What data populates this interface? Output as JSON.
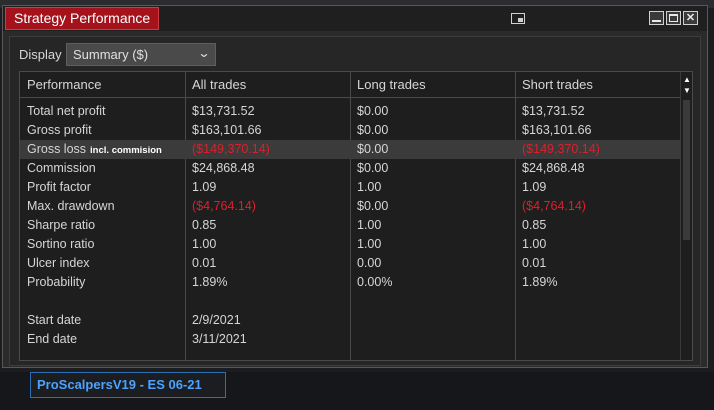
{
  "window": {
    "title": "Strategy Performance",
    "close_symbol": "✕"
  },
  "display": {
    "label": "Display",
    "selected": "Summary ($)"
  },
  "table": {
    "headers": [
      "Performance",
      "All trades",
      "Long trades",
      "Short trades"
    ],
    "rows": [
      {
        "label": "Total net profit",
        "note": "",
        "all": "$13,731.52",
        "long": "$0.00",
        "short": "$13,731.52"
      },
      {
        "label": "Gross profit",
        "note": "",
        "all": "$163,101.66",
        "long": "$0.00",
        "short": "$163,101.66"
      },
      {
        "label": "Gross loss",
        "note": "incl. commision",
        "all": "($149,370.14)",
        "long": "$0.00",
        "short": "($149,370.14)"
      },
      {
        "label": "Commission",
        "note": "",
        "all": "$24,868.48",
        "long": "$0.00",
        "short": "$24,868.48"
      },
      {
        "label": "Profit factor",
        "note": "",
        "all": "1.09",
        "long": "1.00",
        "short": "1.09"
      },
      {
        "label": "Max. drawdown",
        "note": "",
        "all": "($4,764.14)",
        "long": "$0.00",
        "short": "($4,764.14)"
      },
      {
        "label": "Sharpe ratio",
        "note": "",
        "all": "0.85",
        "long": "1.00",
        "short": "0.85"
      },
      {
        "label": "Sortino ratio",
        "note": "",
        "all": "1.00",
        "long": "1.00",
        "short": "1.00"
      },
      {
        "label": "Ulcer index",
        "note": "",
        "all": "0.01",
        "long": "0.00",
        "short": "0.01"
      },
      {
        "label": "Probability",
        "note": "",
        "all": "1.89%",
        "long": "0.00%",
        "short": "1.89%"
      },
      {
        "label": "Start date",
        "note": "",
        "all": "2/9/2021",
        "long": "",
        "short": ""
      },
      {
        "label": "End date",
        "note": "",
        "all": "3/11/2021",
        "long": "",
        "short": ""
      }
    ]
  },
  "bottom_tab": {
    "label": "ProScalpersV19 - ES 06-21"
  },
  "colors": {
    "negative": "#e01e2a",
    "title_tab": "#a4121c",
    "bottom_tab_text": "#4aa3ff"
  }
}
